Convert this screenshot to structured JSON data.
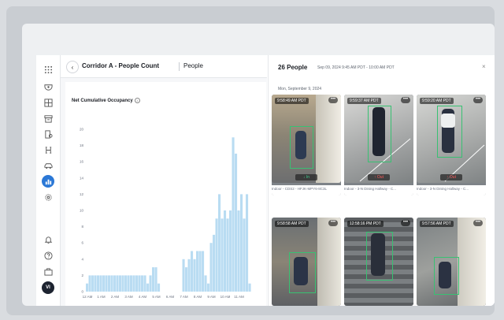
{
  "header": {
    "back_label": "‹",
    "title": "Corridor A - People Count",
    "tab": "People"
  },
  "sidebar": {
    "items": [
      "grid-menu-icon",
      "camera-icon",
      "dashboard-icon",
      "archive-icon",
      "building-icon",
      "network-icon",
      "vehicle-icon",
      "analytics-icon",
      "settings-icon",
      "bell-icon",
      "help-icon",
      "briefcase-icon"
    ],
    "avatar": "VI",
    "accent": "#2b78d6"
  },
  "chart_data": {
    "type": "bar",
    "title": "Net Cumulative Occupancy",
    "ylim": [
      0,
      20
    ],
    "yticks": [
      0,
      2,
      4,
      6,
      8,
      10,
      12,
      14,
      16,
      18,
      20
    ],
    "xtick_labels": [
      "12 AM",
      "1 AM",
      "2 AM",
      "3 AM",
      "4 AM",
      "5 AM",
      "6 AM",
      "7 AM",
      "8 AM",
      "9 AM",
      "10 AM",
      "11 AM"
    ],
    "bar_color": "#b9dcf2",
    "values": [
      1,
      2,
      2,
      2,
      2,
      2,
      2,
      2,
      2,
      2,
      2,
      2,
      2,
      2,
      2,
      2,
      2,
      2,
      2,
      2,
      2,
      2,
      1,
      2,
      3,
      3,
      1,
      0,
      0,
      0,
      0,
      0,
      0,
      0,
      0,
      4,
      3,
      4,
      5,
      4,
      5,
      5,
      5,
      2,
      1,
      6,
      7,
      9,
      12,
      9,
      10,
      9,
      10,
      19,
      17,
      10,
      12,
      9,
      12,
      1
    ],
    "grid": false
  },
  "panel": {
    "title": "26 People",
    "range": "Sep 09, 2024  9:45 AM PDT - 10:00 AM PDT",
    "close_label": "×",
    "date_heading": "Mon, September 9, 2024",
    "more_label": "•••",
    "thumbnails": [
      {
        "time": "9:58:49 AM PDT",
        "direction": "↓ In",
        "dir_color": "#3ecf8e",
        "camera": "Indoor - CDS2 - HFJK-MPY6-8C3L"
      },
      {
        "time": "9:59:37 AM PDT",
        "direction": "↑ Out",
        "dir_color": "#ff5a5a",
        "camera": "Indoor - 3-N Dining Hallway - C..."
      },
      {
        "time": "9:59:20 AM PDT",
        "direction": "↑ Out",
        "dir_color": "#ff5a5a",
        "camera": "Indoor - 3-N Dining Hallway - C..."
      },
      {
        "time": "9:58:58 AM PDT",
        "direction": "",
        "dir_color": "",
        "camera": ""
      },
      {
        "time": "12:58:16 PM PDT",
        "direction": "",
        "dir_color": "",
        "camera": ""
      },
      {
        "time": "9:57:56 AM PDT",
        "direction": "",
        "dir_color": "",
        "camera": ""
      }
    ]
  }
}
